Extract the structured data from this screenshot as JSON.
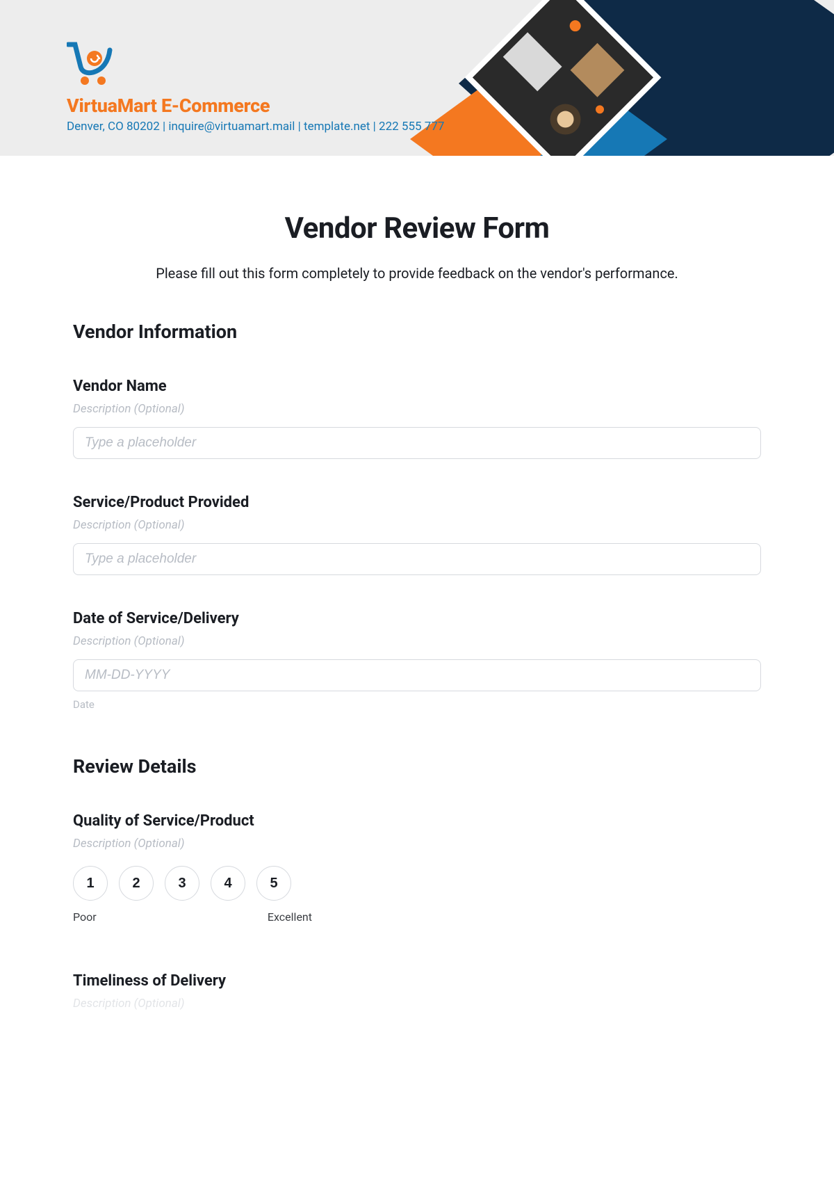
{
  "header": {
    "company_name": "VirtuaMart E-Commerce",
    "info_line": "Denver, CO 80202 | inquire@virtuamart.mail | template.net | 222 555 777"
  },
  "form": {
    "title": "Vendor Review Form",
    "intro": "Please fill out this form completely to provide feedback on the vendor's performance."
  },
  "sections": {
    "vendor_info": {
      "title": "Vendor Information",
      "fields": {
        "vendor_name": {
          "label": "Vendor Name",
          "desc": "Description (Optional)",
          "placeholder": "Type a placeholder"
        },
        "service_product": {
          "label": "Service/Product Provided",
          "desc": "Description (Optional)",
          "placeholder": "Type a placeholder"
        },
        "date_service": {
          "label": "Date of Service/Delivery",
          "desc": "Description (Optional)",
          "placeholder": "MM-DD-YYYY",
          "sublabel": "Date"
        }
      }
    },
    "review_details": {
      "title": "Review Details",
      "fields": {
        "quality": {
          "label": "Quality of Service/Product",
          "desc": "Description (Optional)",
          "ratings": [
            "1",
            "2",
            "3",
            "4",
            "5"
          ],
          "low_label": "Poor",
          "high_label": "Excellent"
        },
        "timeliness": {
          "label": "Timeliness of Delivery",
          "desc": "Description (Optional)"
        }
      }
    }
  }
}
